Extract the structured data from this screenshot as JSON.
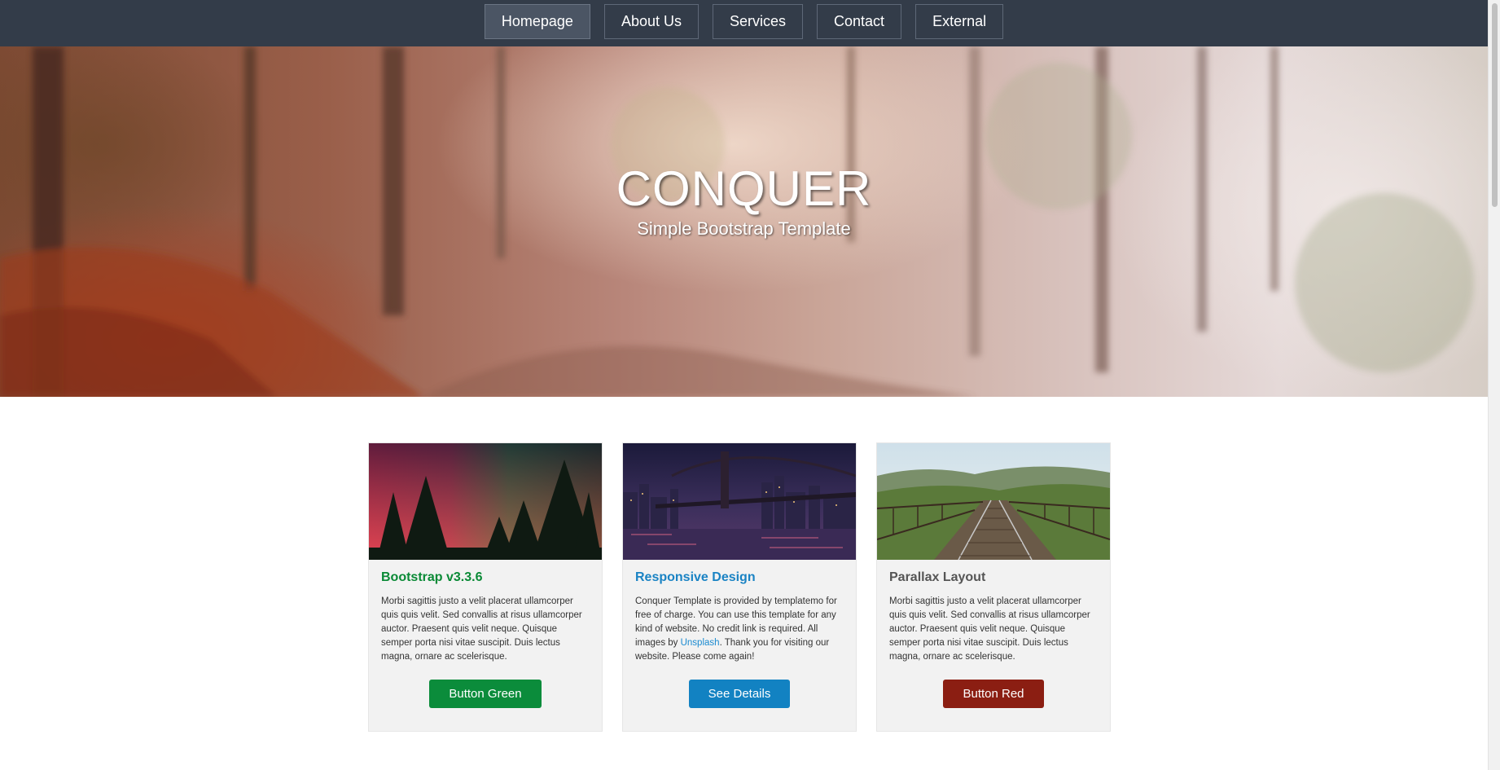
{
  "nav": {
    "items": [
      {
        "label": "Homepage",
        "active": true
      },
      {
        "label": "About Us",
        "active": false
      },
      {
        "label": "Services",
        "active": false
      },
      {
        "label": "Contact",
        "active": false
      },
      {
        "label": "External",
        "active": false
      }
    ]
  },
  "hero": {
    "title": "CONQUER",
    "subtitle": "Simple Bootstrap Template"
  },
  "cards": [
    {
      "title": "Bootstrap v3.3.6",
      "title_color": "#0a8a36",
      "text": "Morbi sagittis justo a velit placerat ullamcorper quis quis velit. Sed convallis at risus ullamcorper auctor. Praesent quis velit neque. Quisque semper porta nisi vitae suscipit. Duis lectus magna, ornare ac scelerisque.",
      "button": "Button Green",
      "button_color": "#0b8c3b"
    },
    {
      "title": "Responsive Design",
      "title_color": "#1a83c4",
      "text_before_link": "Conquer Template is provided by templatemo for free of charge. You can use this template for any kind of website. No credit link is required. All images by ",
      "link_text": "Unsplash",
      "text_after_link": ". Thank you for visiting our website. Please come again!",
      "button": "See Details",
      "button_color": "#1282c2"
    },
    {
      "title": "Parallax Layout",
      "title_color": "#555555",
      "text": "Morbi sagittis justo a velit placerat ullamcorper quis quis velit. Sed convallis at risus ullamcorper auctor. Praesent quis velit neque. Quisque semper porta nisi vitae suscipit. Duis lectus magna, ornare ac scelerisque.",
      "button": "Button Red",
      "button_color": "#8b1e12"
    }
  ]
}
